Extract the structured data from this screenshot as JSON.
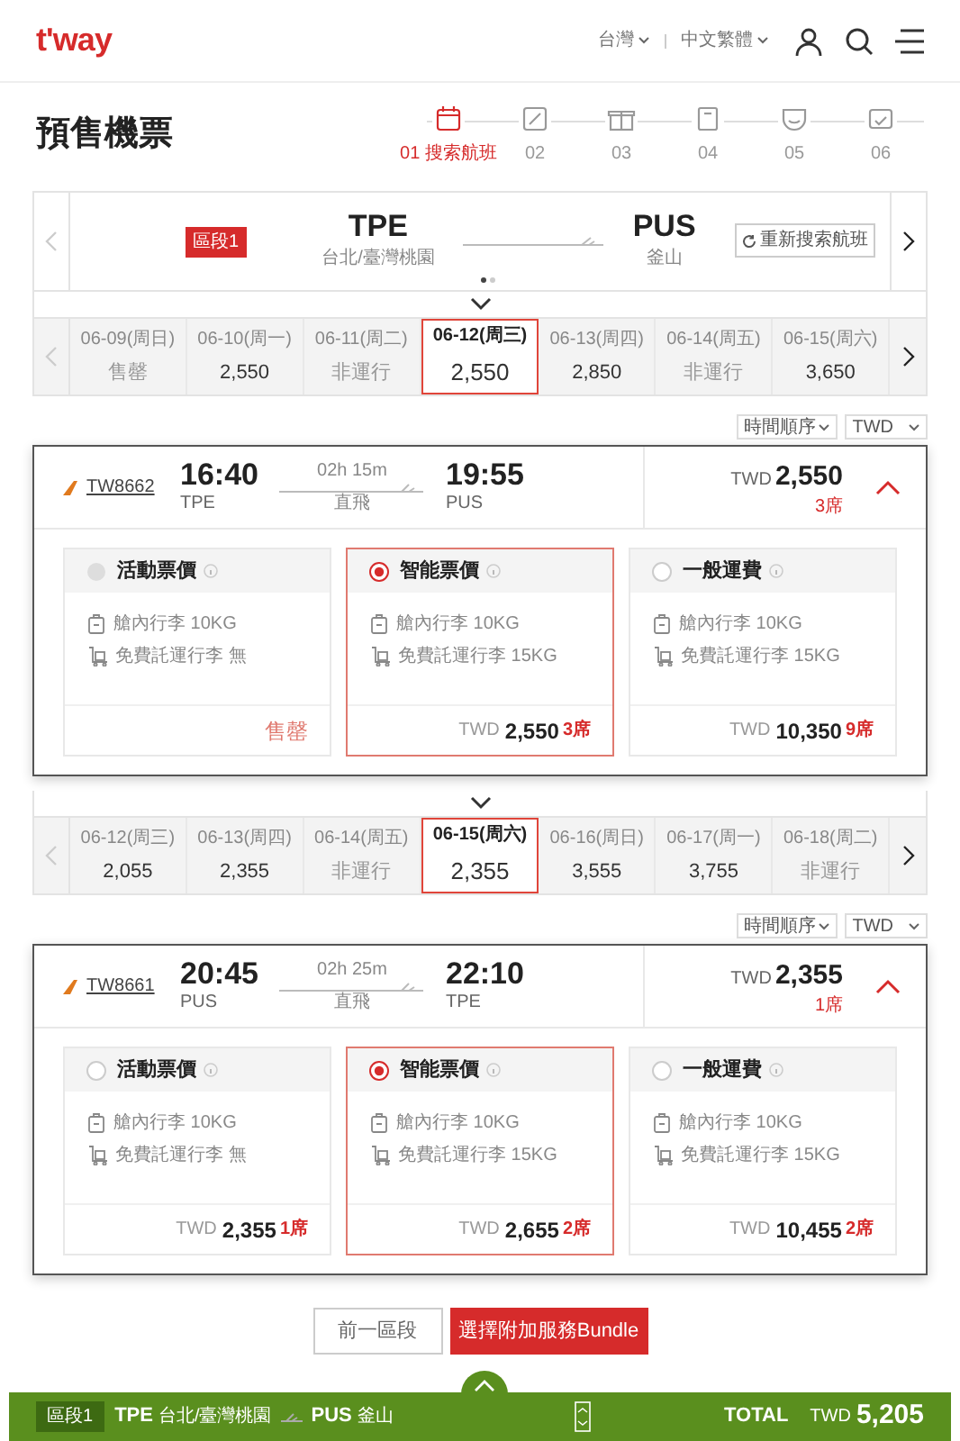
{
  "header": {
    "logo": "t'way",
    "region": "台灣",
    "language": "中文繁體"
  },
  "page_title": "預售機票",
  "steps": [
    {
      "label": "01 搜索航班",
      "selected": true
    },
    {
      "label": "02",
      "selected": false
    },
    {
      "label": "03",
      "selected": false
    },
    {
      "label": "04",
      "selected": false
    },
    {
      "label": "05",
      "selected": false
    },
    {
      "label": "06",
      "selected": false
    }
  ],
  "route": {
    "segment": "區段1",
    "origin_code": "TPE",
    "origin_name": "台北/臺灣桃園",
    "destination_code": "PUS",
    "destination_name": "釜山",
    "reset_button": "重新搜索航班",
    "pages": [
      {
        "selected": true
      },
      {
        "selected": false
      }
    ]
  },
  "segments": [
    {
      "dates": [
        {
          "date": "06-09(周日)",
          "price": "售罄",
          "kind": "unavailable",
          "selected": false
        },
        {
          "date": "06-10(周一)",
          "price": "2,550",
          "kind": "price",
          "selected": false
        },
        {
          "date": "06-11(周二)",
          "price": "非運行",
          "kind": "unavailable",
          "selected": false
        },
        {
          "date": "06-12(周三)",
          "price": "2,550",
          "kind": "price",
          "selected": true
        },
        {
          "date": "06-13(周四)",
          "price": "2,850",
          "kind": "price",
          "selected": false
        },
        {
          "date": "06-14(周五)",
          "price": "非運行",
          "kind": "unavailable",
          "selected": false
        },
        {
          "date": "06-15(周六)",
          "price": "3,650",
          "kind": "price",
          "selected": false
        }
      ],
      "sort": "時間順序",
      "currency": "TWD",
      "flight": {
        "number": "TW8662",
        "depart_time": "16:40",
        "depart_code": "TPE",
        "duration": "02h 15m",
        "type": "直飛",
        "arrive_time": "19:55",
        "arrive_code": "PUS",
        "currency": "TWD",
        "price": "2,550",
        "seats": "3席",
        "expanded": true,
        "fares": [
          {
            "name": "活動票價",
            "selected": false,
            "available": false,
            "cabin_bag": "艙內行李 10KG",
            "checked_bag": "免費託運行李 無",
            "status": "售罄"
          },
          {
            "name": "智能票價",
            "selected": true,
            "available": true,
            "cabin_bag": "艙內行李 10KG",
            "checked_bag": "免費託運行李 15KG",
            "currency": "TWD",
            "price": "2,550",
            "seats": "3席"
          },
          {
            "name": "一般運費",
            "selected": false,
            "available": true,
            "cabin_bag": "艙內行李 10KG",
            "checked_bag": "免費託運行李 15KG",
            "currency": "TWD",
            "price": "10,350",
            "seats": "9席"
          }
        ]
      }
    },
    {
      "dates": [
        {
          "date": "06-12(周三)",
          "price": "2,055",
          "kind": "price",
          "selected": false
        },
        {
          "date": "06-13(周四)",
          "price": "2,355",
          "kind": "price",
          "selected": false
        },
        {
          "date": "06-14(周五)",
          "price": "非運行",
          "kind": "unavailable",
          "selected": false
        },
        {
          "date": "06-15(周六)",
          "price": "2,355",
          "kind": "price",
          "selected": true
        },
        {
          "date": "06-16(周日)",
          "price": "3,555",
          "kind": "price",
          "selected": false
        },
        {
          "date": "06-17(周一)",
          "price": "3,755",
          "kind": "price",
          "selected": false
        },
        {
          "date": "06-18(周二)",
          "price": "非運行",
          "kind": "unavailable",
          "selected": false
        }
      ],
      "sort": "時間順序",
      "currency": "TWD",
      "flight": {
        "number": "TW8661",
        "depart_time": "20:45",
        "depart_code": "PUS",
        "duration": "02h 25m",
        "type": "直飛",
        "arrive_time": "22:10",
        "arrive_code": "TPE",
        "currency": "TWD",
        "price": "2,355",
        "seats": "1席",
        "expanded": true,
        "fares": [
          {
            "name": "活動票價",
            "selected": false,
            "available": true,
            "cabin_bag": "艙內行李 10KG",
            "checked_bag": "免費託運行李 無",
            "currency": "TWD",
            "price": "2,355",
            "seats": "1席"
          },
          {
            "name": "智能票價",
            "selected": true,
            "available": true,
            "cabin_bag": "艙內行李 10KG",
            "checked_bag": "免費託運行李 15KG",
            "currency": "TWD",
            "price": "2,655",
            "seats": "2席"
          },
          {
            "name": "一般運費",
            "selected": false,
            "available": true,
            "cabin_bag": "艙內行李 10KG",
            "checked_bag": "免費託運行李 15KG",
            "currency": "TWD",
            "price": "10,455",
            "seats": "2席"
          }
        ]
      }
    }
  ],
  "buttons": {
    "previous": "前一區段",
    "next": "選擇附加服務Bundle"
  },
  "summary_bar": {
    "segment": "區段1",
    "origin_code": "TPE",
    "origin_name": "台北/臺灣桃園",
    "destination_code": "PUS",
    "destination_name": "釜山",
    "total_label": "TOTAL",
    "currency": "TWD",
    "total": "5,205"
  }
}
